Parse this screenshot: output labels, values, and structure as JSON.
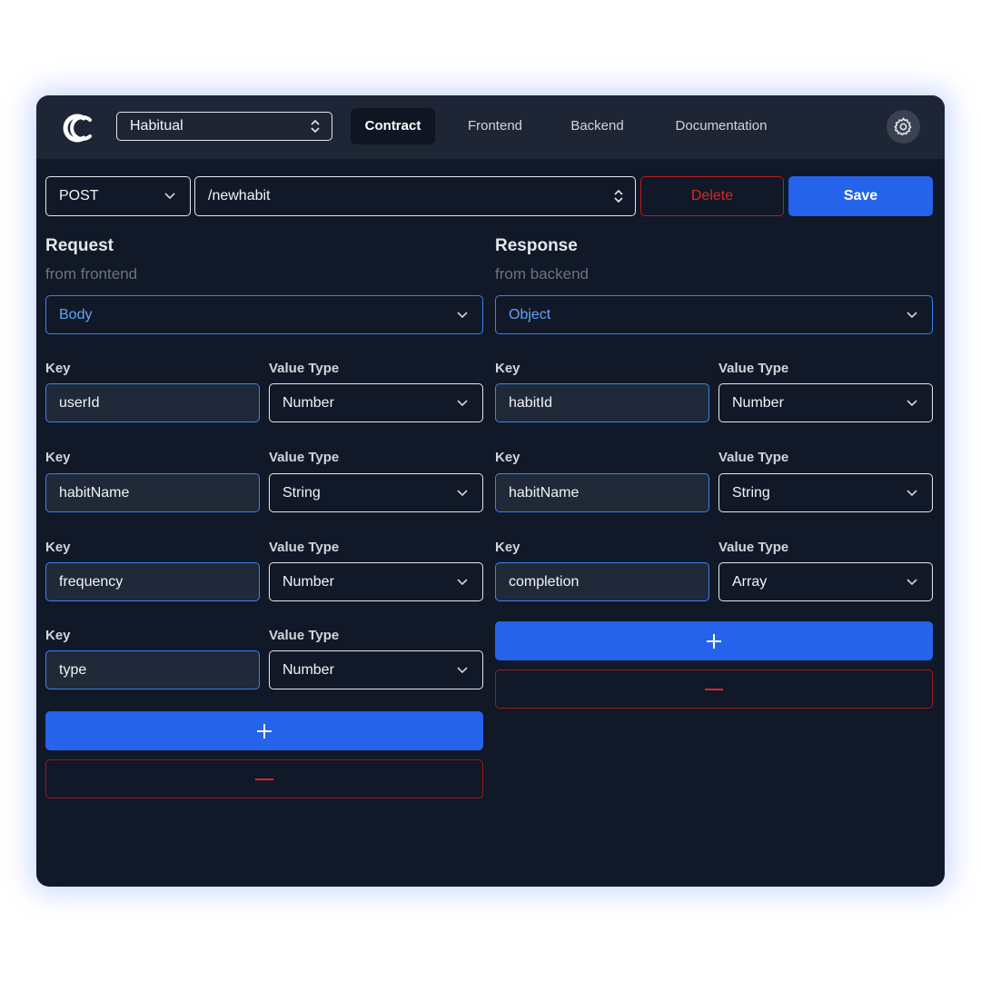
{
  "header": {
    "project": "Habitual",
    "tabs": [
      {
        "label": "Contract",
        "active": true
      },
      {
        "label": "Frontend",
        "active": false
      },
      {
        "label": "Backend",
        "active": false
      },
      {
        "label": "Documentation",
        "active": false
      }
    ]
  },
  "endpoint": {
    "method": "POST",
    "path": "/newhabit",
    "delete_label": "Delete",
    "save_label": "Save"
  },
  "request": {
    "title": "Request",
    "subtitle": "from frontend",
    "location": "Body",
    "key_label": "Key",
    "type_label": "Value Type",
    "fields": [
      {
        "key": "userId",
        "type": "Number"
      },
      {
        "key": "habitName",
        "type": "String"
      },
      {
        "key": "frequency",
        "type": "Number"
      },
      {
        "key": "type",
        "type": "Number"
      }
    ]
  },
  "response": {
    "title": "Response",
    "subtitle": "from backend",
    "location": "Object",
    "key_label": "Key",
    "type_label": "Value Type",
    "fields": [
      {
        "key": "habitId",
        "type": "Number"
      },
      {
        "key": "habitName",
        "type": "String"
      },
      {
        "key": "completion",
        "type": "Array"
      }
    ]
  },
  "colors": {
    "background": "#111827",
    "topbar": "#1e2636",
    "accent": "#2563eb",
    "danger": "#dc2626"
  }
}
